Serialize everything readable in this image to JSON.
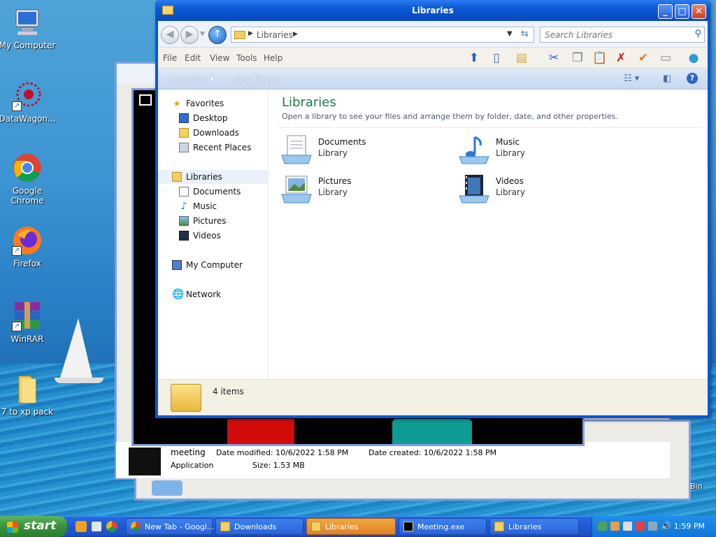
{
  "desktop": {
    "icons": [
      {
        "label": "My Computer",
        "icon": "my-computer-icon"
      },
      {
        "label": "DataWagon...",
        "icon": "datawagon-icon"
      },
      {
        "label": "Google Chrome",
        "icon": "chrome-icon"
      },
      {
        "label": "Firefox",
        "icon": "firefox-icon"
      },
      {
        "label": "WinRAR",
        "icon": "winrar-icon"
      },
      {
        "label": "7 to xp pack",
        "icon": "folder-icon"
      }
    ],
    "bin_label": "Bin"
  },
  "background_details": {
    "name": "meeting",
    "type": "Application",
    "date_modified": "Date modified: 10/6/2022 1:58 PM",
    "size": "Size: 1.53 MB",
    "date_created": "Date created: 10/6/2022 1:58 PM"
  },
  "window": {
    "title": "Libraries",
    "address": {
      "segment": "Libraries"
    },
    "search": {
      "placeholder": "Search Libraries"
    },
    "menu": [
      "File",
      "Edit",
      "View",
      "Tools",
      "Help"
    ],
    "commands": {
      "organize": "Organize",
      "new_library": "New library"
    },
    "nav": {
      "favorites": "Favorites",
      "desktop": "Desktop",
      "downloads": "Downloads",
      "recent": "Recent Places",
      "libraries": "Libraries",
      "documents": "Documents",
      "music": "Music",
      "pictures": "Pictures",
      "videos": "Videos",
      "computer": "My Computer",
      "network": "Network"
    },
    "content": {
      "heading": "Libraries",
      "subtitle": "Open a library to see your files and arrange them by folder, date, and other properties.",
      "libraries": [
        {
          "name": "Documents",
          "type": "Library"
        },
        {
          "name": "Music",
          "type": "Library"
        },
        {
          "name": "Pictures",
          "type": "Library"
        },
        {
          "name": "Videos",
          "type": "Library"
        }
      ]
    },
    "status": {
      "count": "4 items"
    }
  },
  "taskbar": {
    "start": "start",
    "tasks": [
      {
        "label": "New Tab - Googl..."
      },
      {
        "label": "Downloads"
      },
      {
        "label": "Libraries"
      },
      {
        "label": "Meeting.exe"
      },
      {
        "label": "Libraries"
      }
    ],
    "clock": "1:59 PM"
  }
}
